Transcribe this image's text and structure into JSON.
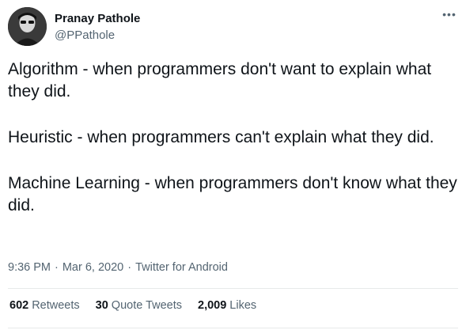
{
  "author": {
    "name": "Pranay Pathole",
    "handle": "@PPathole"
  },
  "more_icon": "ellipsis-icon",
  "tweet": {
    "paragraphs": [
      "Algorithm - when programmers don't want to explain what they did.",
      "Heuristic - when programmers can't explain what they did.",
      "Machine Learning - when programmers don't know what they did."
    ]
  },
  "meta": {
    "time": "9:36 PM",
    "separator": "·",
    "date": "Mar 6, 2020",
    "source": "Twitter for Android"
  },
  "stats": {
    "retweets": {
      "count": "602",
      "label": "Retweets"
    },
    "quote_tweets": {
      "count": "30",
      "label": "Quote Tweets"
    },
    "likes": {
      "count": "2,009",
      "label": "Likes"
    }
  },
  "colors": {
    "text": "#0f1419",
    "secondary": "#536471",
    "divider": "#e7e9ea"
  }
}
